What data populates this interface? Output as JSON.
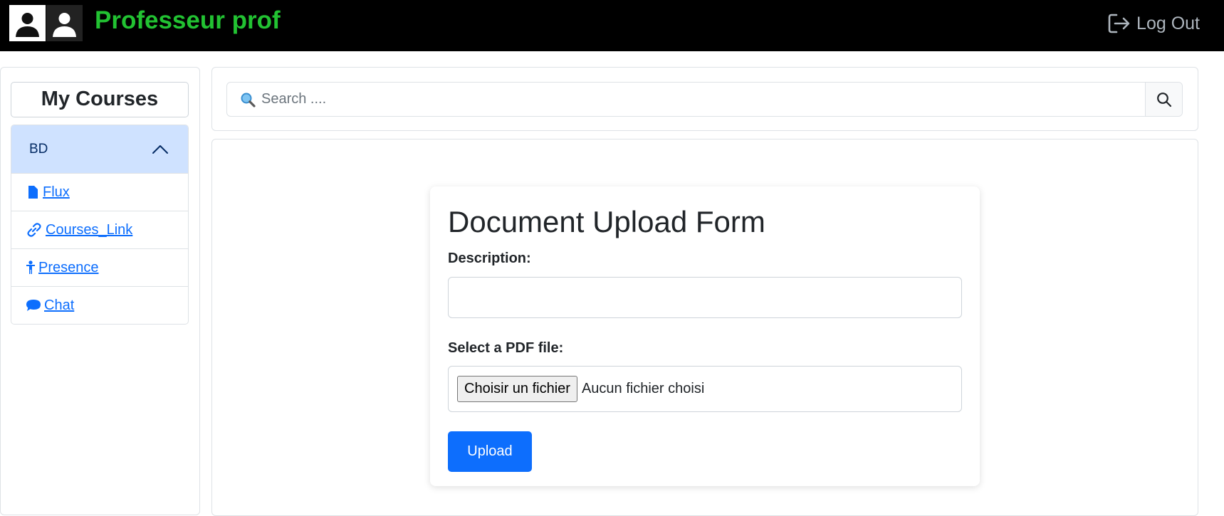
{
  "header": {
    "brand": "Professeur prof",
    "logout_label": "Log Out",
    "brand_color": "#22c232"
  },
  "sidebar": {
    "title": "My Courses",
    "course": {
      "name": "BD",
      "expanded": true,
      "items": [
        {
          "label": " Flux",
          "icon": "file-icon"
        },
        {
          "label": " Courses_Link",
          "icon": "link-icon"
        },
        {
          "label": " Presence",
          "icon": "person-icon"
        },
        {
          "label": " Chat",
          "icon": "chat-icon"
        }
      ]
    }
  },
  "search": {
    "placeholder": "Search ....",
    "value": ""
  },
  "form": {
    "title": "Document Upload Form",
    "description_label": "Description:",
    "description_value": "",
    "file_label": "Select a PDF file:",
    "file_button": "Choisir un fichier",
    "file_status": "Aucun fichier choisi",
    "upload_label": "Upload",
    "accent_color": "#0d6efd"
  }
}
